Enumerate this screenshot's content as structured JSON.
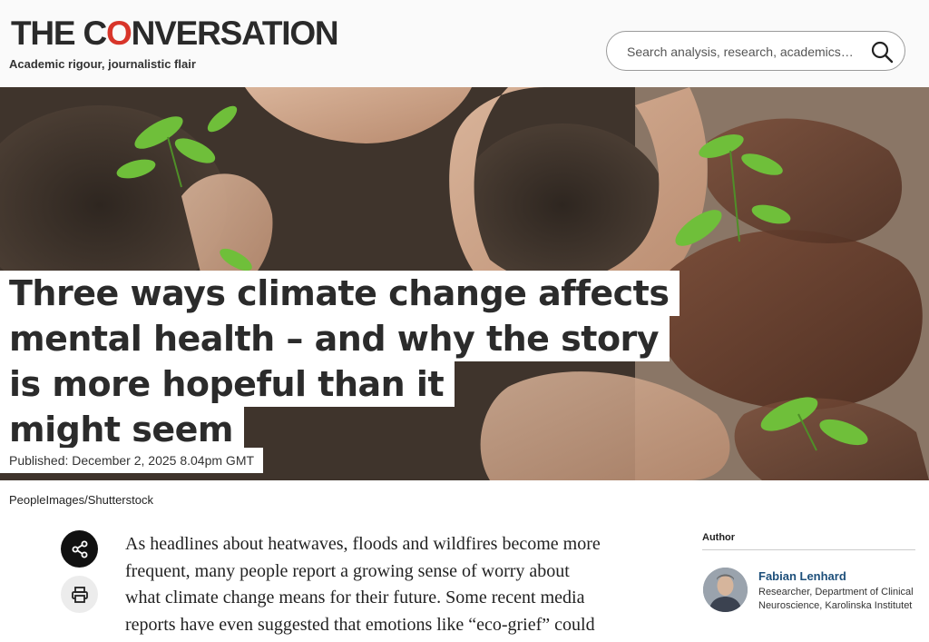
{
  "header": {
    "logo_prefix": "THE C",
    "logo_bubble": "O",
    "logo_suffix": "NVERSATION",
    "tagline": "Academic rigour, journalistic flair",
    "search_placeholder": "Search analysis, research, academics…"
  },
  "article": {
    "title_lines": [
      "Three ways climate change affects",
      "mental health – and why the story",
      "is more hopeful than it",
      "might seem"
    ],
    "published": "Published: December 2, 2025 8.04pm GMT",
    "image_credit": "PeopleImages/Shutterstock",
    "body_lines": [
      "As headlines about heatwaves, floods and wildfires become more",
      "frequent, many people report a growing sense of worry about",
      "what climate change means for their future. Some recent media",
      "reports have even suggested that emotions like “eco-grief” could"
    ]
  },
  "author": {
    "label": "Author",
    "name": "Fabian Lenhard",
    "role": "Researcher, Department of Clinical Neuroscience, Karolinska Institutet"
  },
  "colors": {
    "brand_red": "#d8352a",
    "author_link": "#1d4f7a"
  },
  "icons": {
    "search": "search-icon",
    "share": "share-icon",
    "print": "print-icon"
  }
}
